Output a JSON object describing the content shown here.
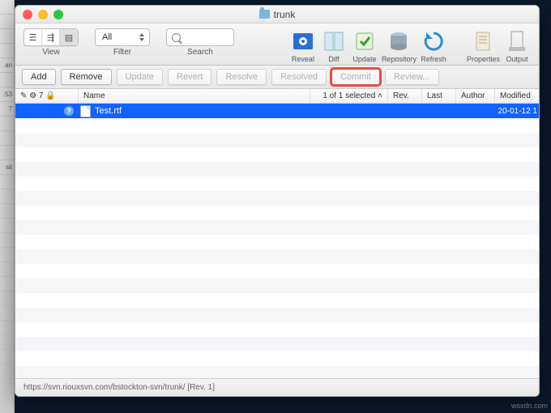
{
  "bg_cells": [
    "",
    "",
    "",
    "",
    "an",
    "",
    ":53",
    "7",
    "",
    "",
    "",
    "sit",
    "",
    "",
    "",
    "",
    "",
    "",
    "",
    "",
    "",
    "",
    "",
    "",
    "",
    "",
    ""
  ],
  "window": {
    "title": "trunk"
  },
  "toolbar": {
    "view_label": "View",
    "filter_label": "Filter",
    "filter_value": "All",
    "search_label": "Search"
  },
  "big_icons": [
    {
      "name": "reveal-icon",
      "label": "Reveal",
      "svg_bg": "#2a6fd6",
      "svg_fg": "#fff"
    },
    {
      "name": "diff-icon",
      "label": "Diff"
    },
    {
      "name": "update-icon",
      "label": "Update"
    },
    {
      "name": "repository-icon",
      "label": "Repository"
    },
    {
      "name": "refresh-icon",
      "label": "Refresh"
    },
    {
      "name": "properties-icon",
      "label": "Properties"
    },
    {
      "name": "output-icon",
      "label": "Output"
    }
  ],
  "buttons": {
    "add": "Add",
    "remove": "Remove",
    "update": "Update",
    "revert": "Revert",
    "resolve": "Resolve",
    "resolved": "Resolved",
    "commit": "Commit",
    "review": "Review..."
  },
  "columns": {
    "flags": "✎ ⚙ 7 🔒",
    "name": "Name",
    "selected": "1 of 1 selected ˄",
    "rev": "Rev.",
    "last": "Last",
    "author": "Author",
    "modified": "Modified"
  },
  "rows": [
    {
      "flag": "?",
      "name": "Test.rtf",
      "modified": "20-01-12 1"
    }
  ],
  "statusbar": "https://svn.riouxsvn.com/bstockton-svn/trunk/   [Rev. 1]",
  "watermark": "wsxdn.com"
}
